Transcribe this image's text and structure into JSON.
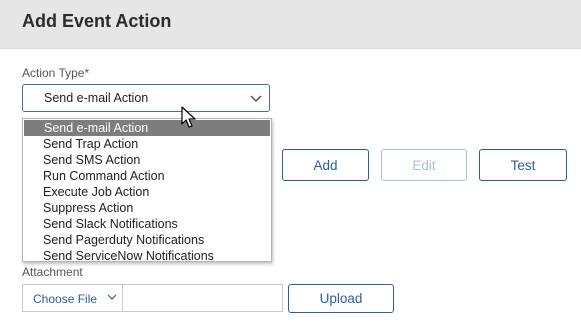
{
  "header": {
    "title": "Add Event Action"
  },
  "action_type": {
    "label": "Action Type*",
    "selected_value": "Send e-mail Action",
    "options": [
      "Send e-mail Action",
      "Send Trap Action",
      "Send SMS Action",
      "Run Command Action",
      "Execute Job Action",
      "Suppress Action",
      "Send Slack Notifications",
      "Send Pagerduty Notifications",
      "Send ServiceNow Notifications"
    ],
    "highlighted_index": 0
  },
  "buttons": {
    "add": "Add",
    "edit": "Edit",
    "test": "Test",
    "upload": "Upload"
  },
  "attachment": {
    "label": "Attachment",
    "choose_file": "Choose File",
    "file_name": ""
  },
  "icons": {
    "select_chevron": "chevron-down-icon",
    "choose_file_chevron": "chevron-down-icon",
    "cursor": "mouse-pointer-icon"
  },
  "colors": {
    "accent": "#2d5f9a",
    "disabled": "#a9c0dc",
    "highlight": "#7d7d7d",
    "header_bg": "#e6e6e6"
  }
}
